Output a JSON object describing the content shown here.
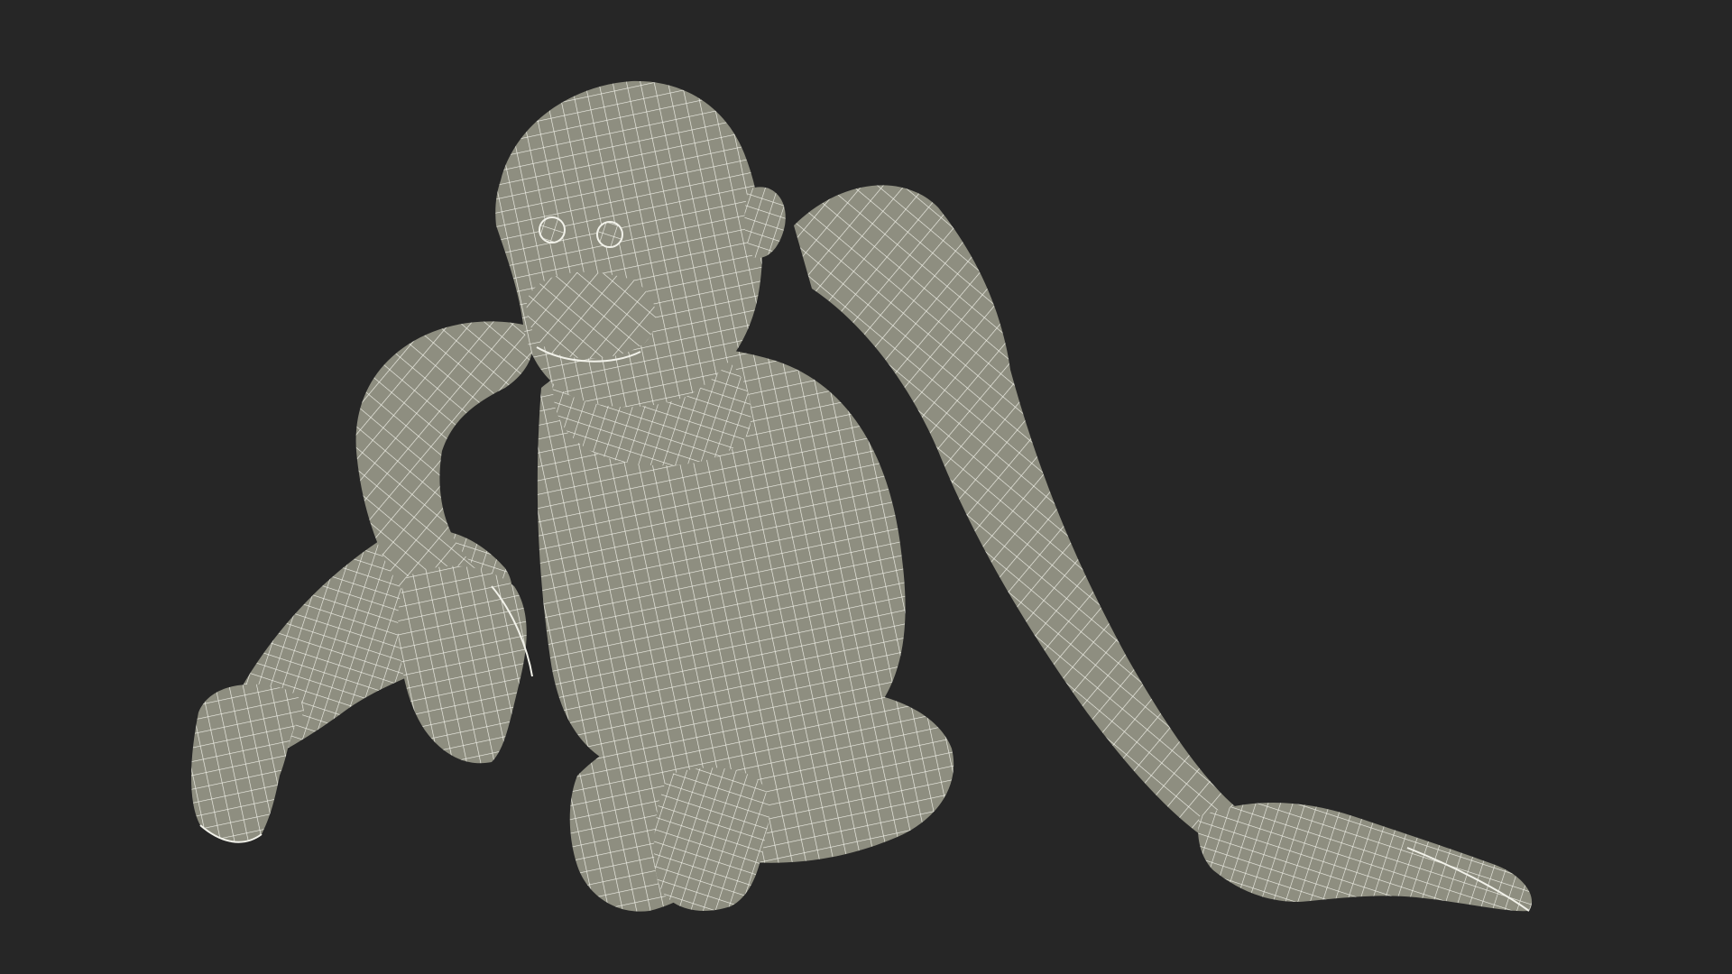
{
  "scene": {
    "background_color": "#262626",
    "mesh_fill_color": "#8e8e80",
    "mesh_shade_color": "#6f6f63",
    "wire_color": "#f2f2ea",
    "subject": "wireframe-ape-model"
  }
}
